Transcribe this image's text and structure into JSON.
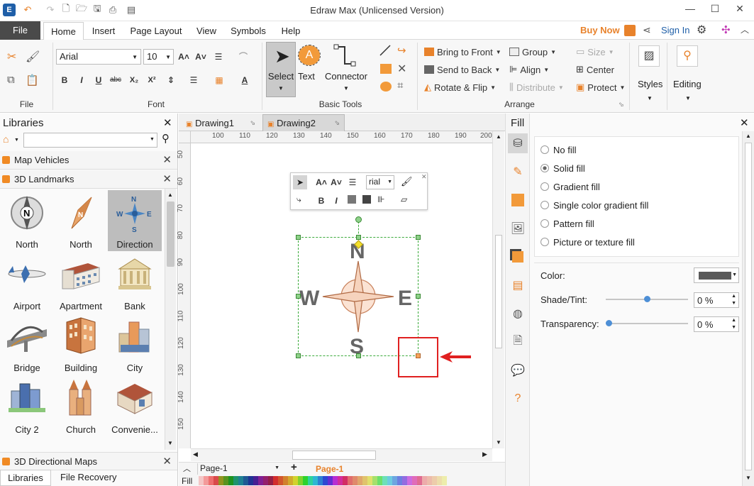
{
  "app": {
    "title": "Edraw Max (Unlicensed Version)"
  },
  "menu": {
    "file": "File",
    "tabs": [
      "Home",
      "Insert",
      "Page Layout",
      "View",
      "Symbols",
      "Help"
    ],
    "buy_now": "Buy Now",
    "sign_in": "Sign In"
  },
  "ribbon": {
    "groups": {
      "file": "File",
      "font": "Font",
      "basic_tools": "Basic Tools",
      "arrange": "Arrange"
    },
    "font_name": "Arial",
    "font_size": "10",
    "select": "Select",
    "text": "Text",
    "connector": "Connector",
    "arrange": {
      "bring_to_front": "Bring to Front",
      "send_to_back": "Send to Back",
      "rotate_flip": "Rotate & Flip",
      "group": "Group",
      "align": "Align",
      "distribute": "Distribute",
      "size": "Size",
      "center": "Center",
      "protect": "Protect"
    },
    "styles": "Styles",
    "editing": "Editing"
  },
  "libraries": {
    "header": "Libraries",
    "search_placeholder": "",
    "sections": [
      "Map Vehicles",
      "3D Landmarks"
    ],
    "shapes": [
      {
        "label": "North",
        "icon": "compass-north-icon"
      },
      {
        "label": "North",
        "icon": "compass-star-icon"
      },
      {
        "label": "Direction",
        "icon": "direction-icon"
      },
      {
        "label": "Airport",
        "icon": "airplane-icon"
      },
      {
        "label": "Apartment",
        "icon": "apartment-icon"
      },
      {
        "label": "Bank",
        "icon": "bank-icon"
      },
      {
        "label": "Bridge",
        "icon": "bridge-icon"
      },
      {
        "label": "Building",
        "icon": "building-icon"
      },
      {
        "label": "City",
        "icon": "city-icon"
      },
      {
        "label": "City 2",
        "icon": "city2-icon"
      },
      {
        "label": "Church",
        "icon": "church-icon"
      },
      {
        "label": "Convenie...",
        "icon": "store-icon"
      }
    ],
    "bottom_section": "3D Directional Maps",
    "bottom_tabs": [
      "Libraries",
      "File Recovery"
    ]
  },
  "documents": {
    "tabs": [
      "Drawing1",
      "Drawing2"
    ]
  },
  "ruler": {
    "h_ticks": [
      "100",
      "110",
      "120",
      "130",
      "140",
      "150",
      "160",
      "170",
      "180",
      "190",
      "200"
    ],
    "v_ticks": [
      "50",
      "60",
      "70",
      "80",
      "90",
      "100",
      "110",
      "120",
      "130",
      "140",
      "150"
    ]
  },
  "mini_toolbar": {
    "font": "rial"
  },
  "canvas": {
    "compass": {
      "n": "N",
      "s": "S",
      "w": "W",
      "e": "E"
    }
  },
  "pages": {
    "current": "Page-1",
    "active_tab": "Page-1",
    "fill_label": "Fill"
  },
  "fill_panel": {
    "header": "Fill",
    "options": [
      "No fill",
      "Solid fill",
      "Gradient fill",
      "Single color gradient fill",
      "Pattern fill",
      "Picture or texture fill"
    ],
    "selected": "Solid fill",
    "color_label": "Color:",
    "color_value": "#5a5a5a",
    "shade_label": "Shade/Tint:",
    "shade_value": "0 %",
    "shade_level": 0.5,
    "transparency_label": "Transparency:",
    "transparency_value": "0 %",
    "transparency_level": 0
  },
  "colors": {
    "accent": "#e8822b",
    "highlight_box": "#e02020"
  }
}
